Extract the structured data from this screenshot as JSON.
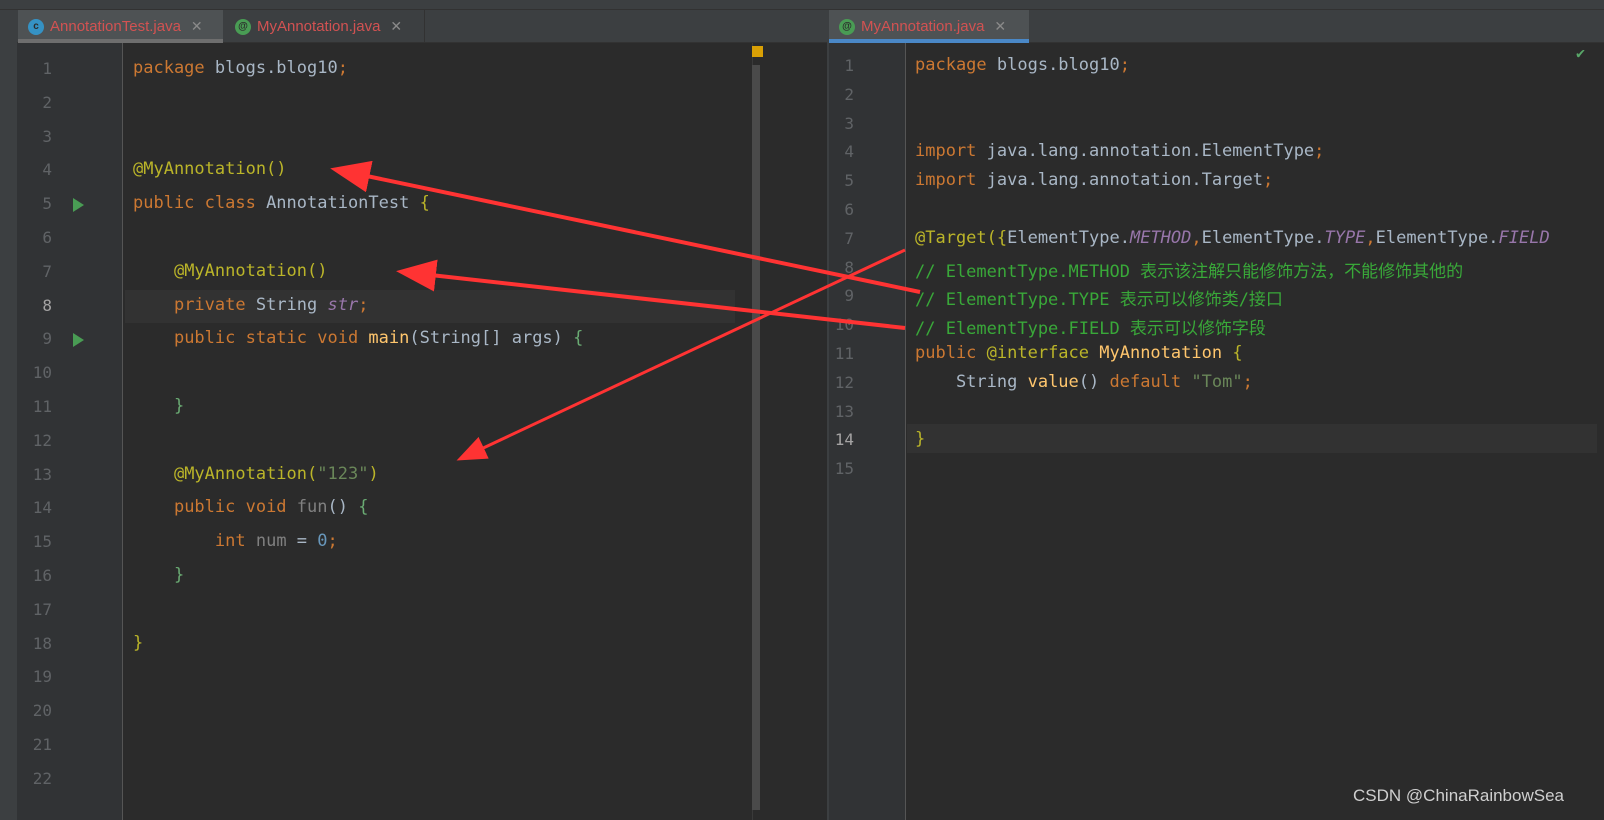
{
  "left_editor": {
    "tabs": [
      {
        "label": "AnnotationTest.java",
        "icon": "class-icon",
        "active": true
      },
      {
        "label": "MyAnnotation.java",
        "icon": "annotation-icon",
        "active": false
      }
    ],
    "lines": [
      [
        [
          "kw",
          "package "
        ],
        [
          "",
          "blogs.blog10"
        ],
        [
          "kw",
          ";"
        ]
      ],
      [],
      [],
      [
        [
          "ann",
          "@MyAnnotation()"
        ]
      ],
      [
        [
          "kw",
          "public class "
        ],
        [
          "",
          "AnnotationTest "
        ],
        [
          "ann",
          "{"
        ]
      ],
      [],
      [
        [
          "",
          "    "
        ],
        [
          "ann",
          "@MyAnnotation()"
        ]
      ],
      [
        [
          "",
          "    "
        ],
        [
          "kw",
          "private "
        ],
        [
          "",
          "String "
        ],
        [
          "it",
          "str"
        ],
        [
          "kw",
          ";"
        ]
      ],
      [
        [
          "",
          "    "
        ],
        [
          "kw",
          "public static void "
        ],
        [
          "fn",
          "main"
        ],
        [
          "",
          "(String[] args) "
        ],
        [
          "br",
          "{"
        ]
      ],
      [],
      [
        [
          "",
          "    "
        ],
        [
          "br",
          "}"
        ]
      ],
      [],
      [
        [
          "",
          "    "
        ],
        [
          "ann",
          "@MyAnnotation("
        ],
        [
          "str",
          "\"123\""
        ],
        [
          "ann",
          ")"
        ]
      ],
      [
        [
          "",
          "    "
        ],
        [
          "kw",
          "public void "
        ],
        [
          "gr",
          "fun"
        ],
        [
          "",
          "() "
        ],
        [
          "br",
          "{"
        ]
      ],
      [
        [
          "",
          "        "
        ],
        [
          "kw",
          "int "
        ],
        [
          "gr",
          "num"
        ],
        [
          "",
          " = "
        ],
        [
          "num",
          "0"
        ],
        [
          "kw",
          ";"
        ]
      ],
      [
        [
          "",
          "    "
        ],
        [
          "br",
          "}"
        ]
      ],
      [],
      [
        [
          "ann",
          "}"
        ]
      ],
      [],
      [],
      [],
      []
    ]
  },
  "right_editor": {
    "tabs": [
      {
        "label": "MyAnnotation.java",
        "icon": "annotation-icon",
        "active": true
      }
    ],
    "lines": [
      [
        [
          "kw",
          "package "
        ],
        [
          "",
          "blogs.blog10"
        ],
        [
          "kw",
          ";"
        ]
      ],
      [],
      [],
      [
        [
          "kw",
          "import "
        ],
        [
          "",
          "java.lang.annotation.ElementType"
        ],
        [
          "kw",
          ";"
        ]
      ],
      [
        [
          "kw",
          "import "
        ],
        [
          "",
          "java.lang.annotation.Target"
        ],
        [
          "kw",
          ";"
        ]
      ],
      [],
      [
        [
          "ann",
          "@Target("
        ],
        [
          "ann",
          "{"
        ],
        [
          "",
          "ElementType."
        ],
        [
          "it",
          "METHOD"
        ],
        [
          "kw",
          ","
        ],
        [
          "",
          "ElementType."
        ],
        [
          "it",
          "TYPE"
        ],
        [
          "kw",
          ","
        ],
        [
          "",
          "ElementType."
        ],
        [
          "it",
          "FIELD"
        ]
      ],
      [
        [
          "cm",
          "// ElementType.METHOD 表示该注解只能修饰方法，不能修饰其他的"
        ]
      ],
      [
        [
          "cm",
          "// ElementType.TYPE 表示可以修饰类/接口"
        ]
      ],
      [
        [
          "cm",
          "// ElementType.FIELD 表示可以修饰字段"
        ]
      ],
      [
        [
          "kw",
          "public "
        ],
        [
          "ann",
          "@interface "
        ],
        [
          "fn",
          "MyAnnotation "
        ],
        [
          "ann",
          "{"
        ]
      ],
      [
        [
          "",
          "    String "
        ],
        [
          "fn",
          "value"
        ],
        [
          "",
          "() "
        ],
        [
          "kw",
          "default "
        ],
        [
          "str",
          "\"Tom\""
        ],
        [
          "kw",
          ";"
        ]
      ],
      [],
      [
        [
          "ann",
          "}"
        ]
      ],
      []
    ]
  },
  "watermark": "CSDN @ChinaRainbowSea",
  "colors": {
    "arrow": "#ff3333",
    "tab_active_underline": "#4a88c7",
    "inspection_ok": "#59a869"
  }
}
